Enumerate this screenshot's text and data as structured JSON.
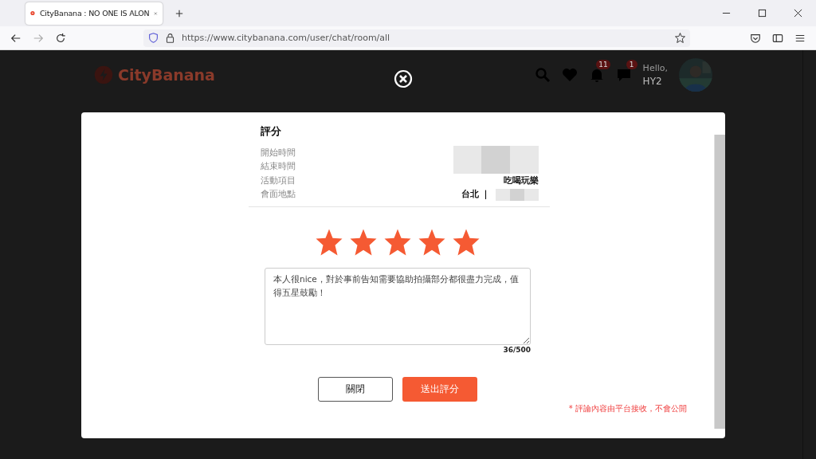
{
  "browser": {
    "tab_title": "CityBanana : NO ONE IS ALON",
    "url": "https://www.citybanana.com/user/chat/room/all"
  },
  "site_header": {
    "logo": "CityBanana",
    "notification_count": "11",
    "message_count": "1",
    "greeting": "Hello,",
    "username": "HY2"
  },
  "modal": {
    "title": "評分",
    "details": [
      {
        "label": "開始時間",
        "redacted": true
      },
      {
        "label": "結束時間",
        "redacted": true
      },
      {
        "label": "活動項目",
        "value": "吃喝玩樂",
        "redacted": false
      },
      {
        "label": "會面地點",
        "value": "台北 ｜",
        "redacted": true
      }
    ],
    "stars": 5,
    "comment": "本人很nice，對於事前告知需要協助拍攝部分都很盡力完成，值得五星鼓勵！",
    "counter": "36/500",
    "buttons": [
      {
        "label": "關閉",
        "kind": "secondary"
      },
      {
        "label": "送出評分",
        "kind": "primary"
      }
    ],
    "notice": "* 評論內容由平台接收，不會公開"
  }
}
